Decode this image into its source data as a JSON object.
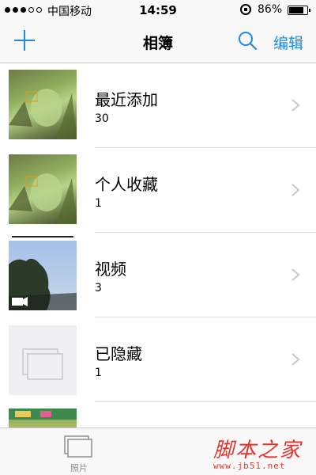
{
  "status_bar": {
    "carrier": "中国移动",
    "time": "14:59",
    "battery_percent": "86%",
    "battery_level": 0.86
  },
  "nav": {
    "add_icon": "plus-icon",
    "title": "相簿",
    "search_icon": "search-icon",
    "edit_label": "编辑"
  },
  "albums": [
    {
      "name": "最近添加",
      "count": "30",
      "thumb": "plant-photo"
    },
    {
      "name": "个人收藏",
      "count": "1",
      "thumb": "plant-photo"
    },
    {
      "name": "视频",
      "count": "3",
      "thumb": "tree-sky-photo",
      "badge_icon": "video-camera-icon"
    },
    {
      "name": "已隐藏",
      "count": "1",
      "thumb": "empty-album-icon"
    },
    {
      "name": "",
      "count": "",
      "thumb": "game-screenshot"
    }
  ],
  "tab_bar": {
    "tabs": [
      {
        "label": "照片",
        "icon": "photos-stack-icon"
      }
    ]
  },
  "watermark": {
    "text": "脚本之家",
    "url": "www.jb51.net"
  },
  "colors": {
    "accent": "#1f8be5",
    "separator": "#c8c8cc",
    "bar_bg": "#f8f8f8",
    "watermark": "#e0362c"
  }
}
